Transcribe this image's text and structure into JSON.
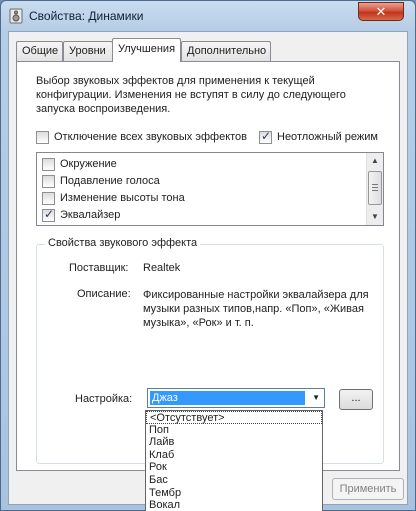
{
  "window": {
    "title": "Свойства: Динамики",
    "close_label": "✕"
  },
  "tabs": [
    {
      "label": "Общие",
      "active": false
    },
    {
      "label": "Уровни",
      "active": false
    },
    {
      "label": "Улучшения",
      "active": true
    },
    {
      "label": "Дополнительно",
      "active": false
    }
  ],
  "enhancements": {
    "description": "Выбор звуковых эффектов для применения к текущей конфигурации. Изменения не вступят в силу до следующего запуска воспроизведения.",
    "disable_all": {
      "label": "Отключение всех звуковых эффектов",
      "checked": false
    },
    "immediate_mode": {
      "label": "Неотложный режим",
      "checked": true
    },
    "effects": [
      {
        "label": "Окружение",
        "checked": false
      },
      {
        "label": "Подавление голоса",
        "checked": false
      },
      {
        "label": "Изменение высоты тона",
        "checked": false
      },
      {
        "label": "Эквалайзер",
        "checked": true
      }
    ]
  },
  "properties": {
    "group_title": "Свойства звукового эффекта",
    "provider_label": "Поставщик:",
    "provider_value": "Realtek",
    "description_label": "Описание:",
    "description_value": "Фиксированные настройки эквалайзера для музыки разных типов,напр. «Поп», «Живая музыка», «Рок» и т. п.",
    "setting_label": "Настройка:",
    "setting_value": "Джаз",
    "more_button": "...",
    "dropdown_options": [
      "<Отсутствует>",
      "Поп",
      "Лайв",
      "Клаб",
      "Рок",
      "Бас",
      "Тембр",
      "Вокал"
    ]
  },
  "footer": {
    "apply_label": "Применить"
  }
}
